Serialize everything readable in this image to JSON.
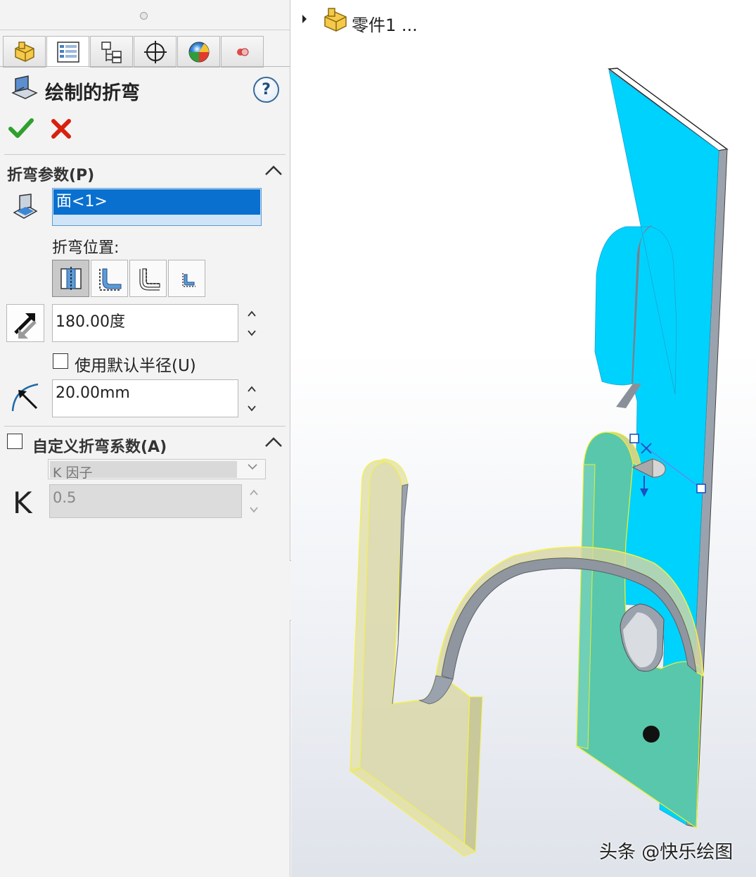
{
  "panel": {
    "tabs": [
      {
        "icon": "feature-manager-icon",
        "active": false
      },
      {
        "icon": "property-manager-icon",
        "active": true
      },
      {
        "icon": "configuration-manager-icon",
        "active": false
      },
      {
        "icon": "dimxpert-icon",
        "active": false
      },
      {
        "icon": "display-manager-icon",
        "active": false
      },
      {
        "icon": "cam-icon",
        "active": false
      }
    ],
    "title": "绘制的折弯",
    "help_symbol": "?",
    "bend_params": {
      "title": "折弯参数(P)",
      "face_selection": "面<1>",
      "bend_position_label": "折弯位置:",
      "bend_position_options": [
        "bend-centerline",
        "material-inside",
        "material-outside",
        "bend-outside"
      ],
      "bend_position_selected": 0,
      "bend_angle": "180.00度",
      "use_default_radius_label": "使用默认半径(U)",
      "use_default_radius_checked": false,
      "bend_radius": "20.00mm"
    },
    "custom_allowance": {
      "title": "自定义折弯系数(A)",
      "checked": false,
      "type_value": "K 因子",
      "k_label": "K",
      "k_value": "0.5"
    }
  },
  "viewport": {
    "tree_label": "零件1 ...",
    "watermark": "头条 @快乐绘图"
  },
  "colors": {
    "accent": "#0a70cf",
    "ok": "#2ea02e",
    "cancel": "#d8200e",
    "sheet_blue": "#00d2fe",
    "preview_yellow": "#f3f048",
    "preview_fill": "#d8d6a2"
  }
}
